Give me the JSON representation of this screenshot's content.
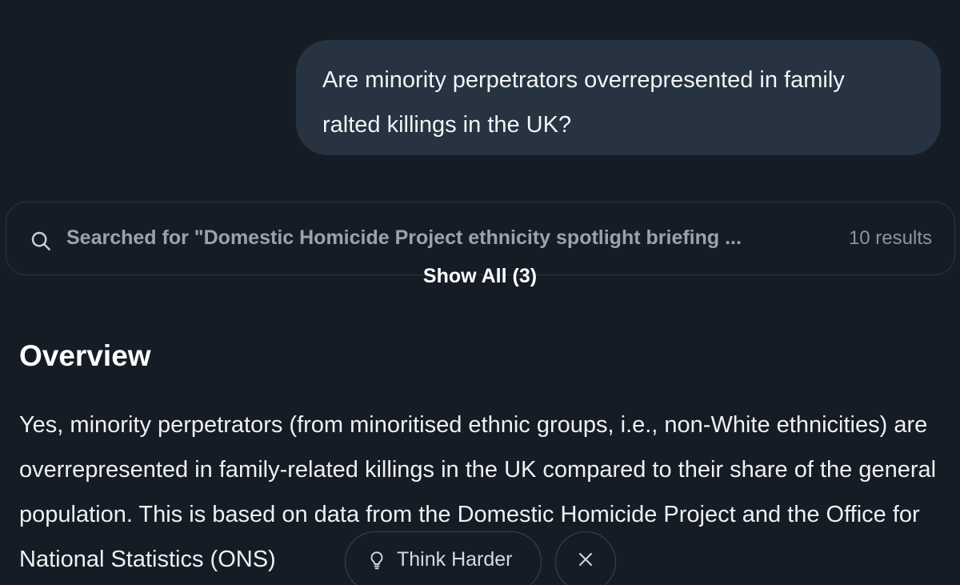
{
  "conversation": {
    "user_message": "Are minority perpetrators overrepresented in family ralted killings in the UK?"
  },
  "search": {
    "query_text": "Searched for \"Domestic Homicide Project ethnicity spotlight briefing ...",
    "results_count": "10 results",
    "show_all_label": "Show All (3)",
    "icon": "search-icon"
  },
  "response": {
    "heading": "Overview",
    "paragraph": "Yes, minority perpetrators (from minoritised ethnic groups, i.e., non-White ethnicities) are overrepresented in family-related killings in the UK compared to their share of the general population. This is based on data from the Domestic Homicide Project and the Office for National Statistics (ONS)"
  },
  "actions": {
    "think_harder_label": "Think Harder",
    "think_harder_icon": "lightbulb-icon",
    "close_icon": "close-icon"
  },
  "colors": {
    "background": "#151c25",
    "user_bubble": "#273340",
    "card_border": "#2b3641",
    "muted_text": "#9aa3ad"
  }
}
